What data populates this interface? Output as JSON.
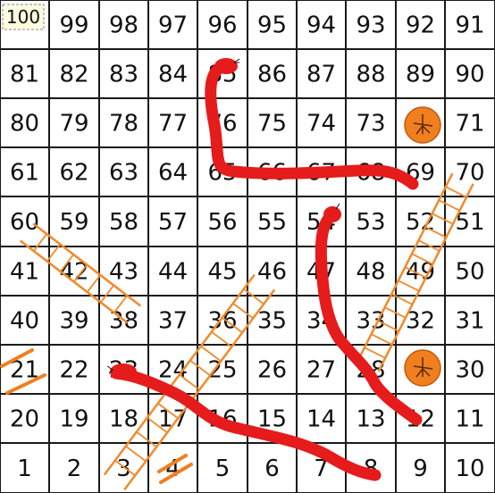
{
  "board": {
    "rows": [
      [
        "100",
        "99",
        "98",
        "97",
        "96",
        "95",
        "94",
        "93",
        "92",
        "91"
      ],
      [
        "81",
        "82",
        "83",
        "84",
        "85",
        "86",
        "87",
        "88",
        "89",
        "90"
      ],
      [
        "80",
        "79",
        "78",
        "77",
        "76",
        "75",
        "74",
        "73",
        "72",
        "71"
      ],
      [
        "61",
        "62",
        "63",
        "64",
        "65",
        "66",
        "67",
        "68",
        "69",
        "70"
      ],
      [
        "60",
        "59",
        "58",
        "57",
        "56",
        "55",
        "54",
        "53",
        "52",
        "51"
      ],
      [
        "41",
        "42",
        "43",
        "44",
        "45",
        "46",
        "47",
        "48",
        "49",
        "50"
      ],
      [
        "40",
        "39",
        "38",
        "37",
        "36",
        "35",
        "34",
        "33",
        "32",
        "31"
      ],
      [
        "21",
        "22",
        "23",
        "24",
        "25",
        "26",
        "27",
        "28",
        "29",
        "30"
      ],
      [
        "20",
        "19",
        "18",
        "17",
        "16",
        "15",
        "14",
        "13",
        "12",
        "11"
      ],
      [
        "1",
        "2",
        "3",
        "4",
        "5",
        "6",
        "7",
        "8",
        "9",
        "10"
      ]
    ]
  },
  "colors": {
    "snake": "#e61b1b",
    "ladder": "#f08a2c",
    "marker": "#f07f1f",
    "grid": "#1a1a1a"
  },
  "snakes": [
    {
      "head": "85",
      "tail": "69"
    },
    {
      "head": "54",
      "tail": "12"
    },
    {
      "head": "23",
      "tail": "8"
    }
  ],
  "ladders": [
    {
      "bottom": "28",
      "top": "70"
    },
    {
      "bottom": "3",
      "top": "46"
    },
    {
      "bottom": "38",
      "top": "60"
    }
  ],
  "markers": [
    {
      "icon": "orange-circle-icon",
      "cell": "72"
    },
    {
      "icon": "orange-circle-icon",
      "cell": "29"
    }
  ]
}
